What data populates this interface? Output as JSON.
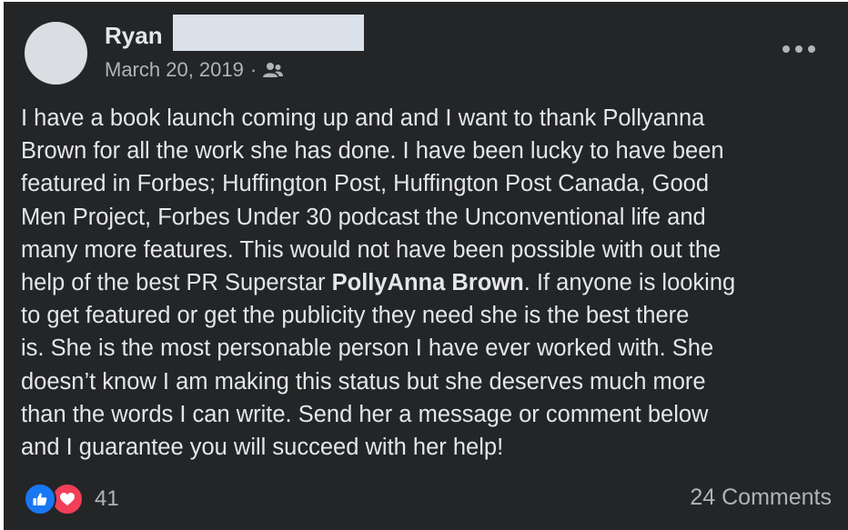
{
  "post": {
    "author_name": "Ryan",
    "timestamp": "March 20, 2019",
    "separator": "·",
    "audience_icon": "friends-icon",
    "body_lines": [
      "I have a book launch coming up and and I want to thank Pollyanna",
      "Brown for all the work she has done. I have been lucky to have been",
      "featured in Forbes; Huffington Post, Huffington Post Canada,  Good",
      "Men Project, Forbes Under 30 podcast the Unconventional life and",
      "many more features. This would not have been possible with out the"
    ],
    "line6_before": "help of the best PR Superstar ",
    "mention": "PollyAnna Brown",
    "line6_after": ". If anyone is looking",
    "body_lines_after": [
      "to get featured or get the publicity they need she is the best there",
      "is. She is the most personable person I have ever worked with. She",
      "doesn’t know I am making this status but she deserves much more",
      "than the words I can write. Send her a message or comment below",
      "and I guarantee you will succeed with her help!"
    ]
  },
  "reactions": {
    "icons": [
      "like-icon",
      "love-icon"
    ],
    "count": "41"
  },
  "comments": {
    "label": "24 Comments"
  },
  "colors": {
    "background": "#242526",
    "text_primary": "#e4e6eb",
    "text_secondary": "#b0b3b8",
    "like_blue": "#1877f2",
    "love_red": "#f33e58",
    "redaction": "#dbe1ea"
  }
}
